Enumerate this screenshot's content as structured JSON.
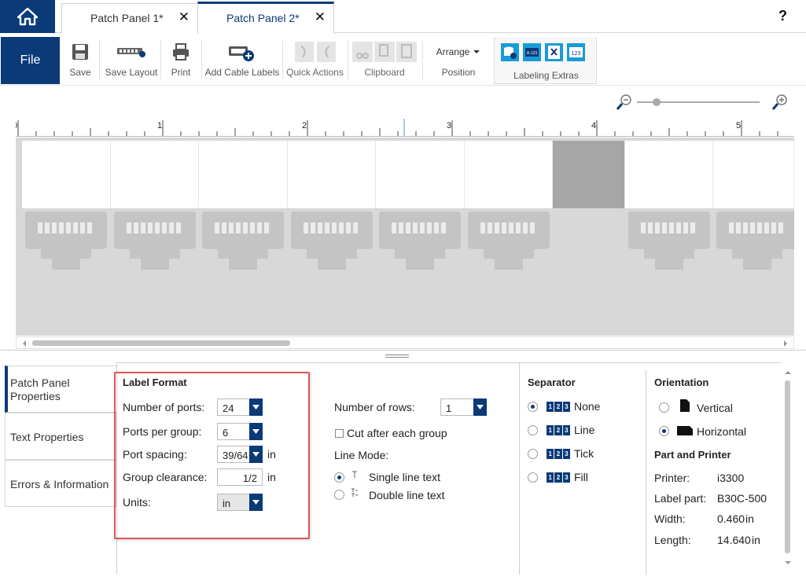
{
  "tabs": [
    {
      "label": "Patch Panel 1*",
      "close": "✕"
    },
    {
      "label": "Patch Panel 2*",
      "close": "✕"
    }
  ],
  "help_label": "?",
  "ribbon": {
    "file_label": "File",
    "save_label": "Save",
    "save_layout_label": "Save Layout",
    "print_label": "Print",
    "add_cable_labels_label": "Add Cable Labels",
    "quick_actions_label": "Quick Actions",
    "clipboard_label": "Clipboard",
    "arrange_label": "Arrange",
    "position_label": "Position",
    "labeling_extras_label": "Labeling Extras",
    "extra_icons": [
      "db-label-icon",
      "a-123-icon",
      "x-label-icon",
      "123-icon"
    ],
    "extra_icon_texts": [
      "A-123",
      "123"
    ]
  },
  "ruler": {
    "ticks": [
      "0",
      "1",
      "2",
      "3",
      "4",
      "5"
    ]
  },
  "nav": {
    "items": [
      {
        "label": "Patch Panel Properties",
        "active": true
      },
      {
        "label": "Text Properties",
        "active": false
      },
      {
        "label": "Errors & Information",
        "active": false
      }
    ]
  },
  "label_format": {
    "title": "Label Format",
    "number_of_ports_label": "Number of ports:",
    "number_of_ports_value": "24",
    "ports_per_group_label": "Ports per group:",
    "ports_per_group_value": "6",
    "port_spacing_label": "Port spacing:",
    "port_spacing_value": "39/64",
    "port_spacing_unit": "in",
    "group_clearance_label": "Group clearance:",
    "group_clearance_value": "1/2",
    "group_clearance_unit": "in",
    "units_label": "Units:",
    "units_value": "in"
  },
  "rows": {
    "number_of_rows_label": "Number of rows:",
    "number_of_rows_value": "1",
    "cut_after_label": "Cut after each group",
    "line_mode_label": "Line Mode:",
    "single_line_label": "Single line text",
    "double_line_label": "Double line text"
  },
  "separator": {
    "title": "Separator",
    "options": [
      "None",
      "Line",
      "Tick",
      "Fill"
    ],
    "selected": "None",
    "icon_digits": [
      "1",
      "2",
      "3"
    ]
  },
  "orientation": {
    "title": "Orientation",
    "vertical_label": "Vertical",
    "horizontal_label": "Horizontal",
    "selected": "Horizontal"
  },
  "part_printer": {
    "title": "Part and Printer",
    "printer_label": "Printer:",
    "printer_value": "i3300",
    "label_part_label": "Label part:",
    "label_part_value": "B30C-500",
    "width_label": "Width:",
    "width_value": "0.460",
    "width_unit": "in",
    "length_label": "Length:",
    "length_value": "14.640",
    "length_unit": "in"
  },
  "colors": {
    "accent": "#0a3a78",
    "highlight": "#e05555",
    "extras_icon": "#1a9bd7"
  }
}
